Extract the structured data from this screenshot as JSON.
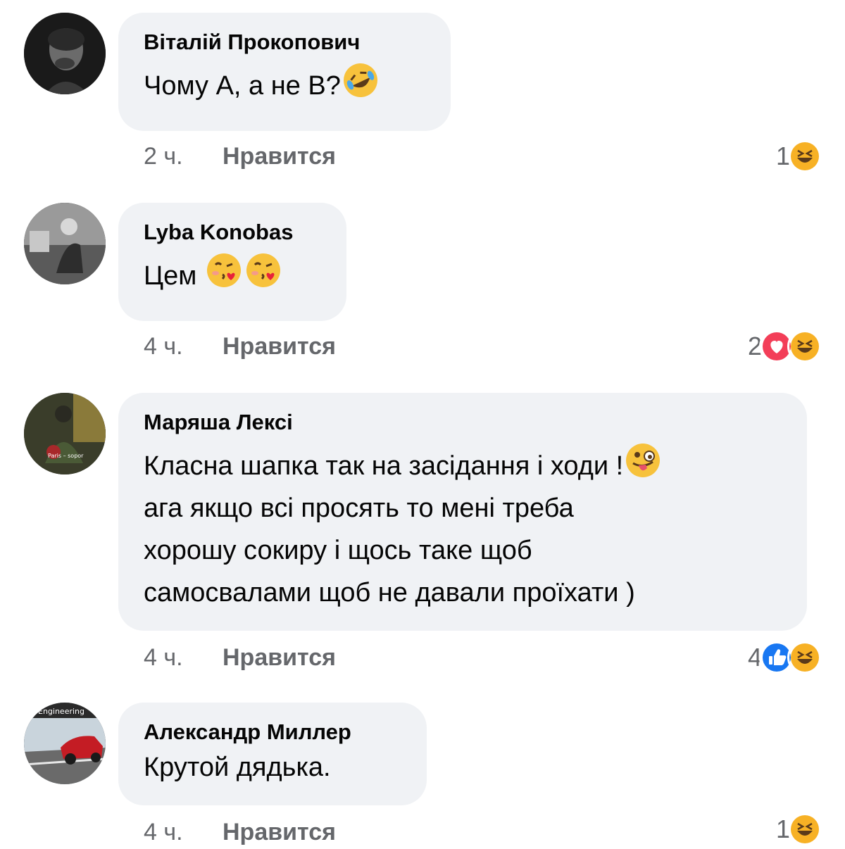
{
  "comments": [
    {
      "author": "Віталій Прокопович",
      "text": "Чому А, а не В?",
      "time": "2 ч.",
      "like_label": "Нравится",
      "reaction_count": "1",
      "reactions": [
        "haha"
      ]
    },
    {
      "author": "Lyba Konobas",
      "text": "Цем",
      "time": "4 ч.",
      "like_label": "Нравится",
      "reaction_count": "2",
      "reactions": [
        "love",
        "haha"
      ]
    },
    {
      "author": "Маряша Лексі",
      "text_lines": [
        "Класна шапка так на засідання і ходи !",
        "ага якщо всі просять то мені треба",
        "хорошу сокиру і щось таке щоб",
        "самосвалами щоб не давали проїхати )"
      ],
      "time": "4 ч.",
      "like_label": "Нравится",
      "reaction_count": "4",
      "reactions": [
        "like",
        "haha"
      ],
      "avatar_caption": "Paris – sopor"
    },
    {
      "author": "Александр Миллер",
      "text": "Крутой дядька.",
      "time": "4 ч.",
      "like_label": "Нравится",
      "reaction_count": "1",
      "reactions": [
        "haha"
      ],
      "avatar_caption": "Engineering"
    }
  ],
  "colors": {
    "bubble": "#f0f2f5",
    "meta_text": "#65676b",
    "like_blue": "#1877f2",
    "love_red": "#f33e58",
    "haha_yellow": "#f7b125"
  }
}
